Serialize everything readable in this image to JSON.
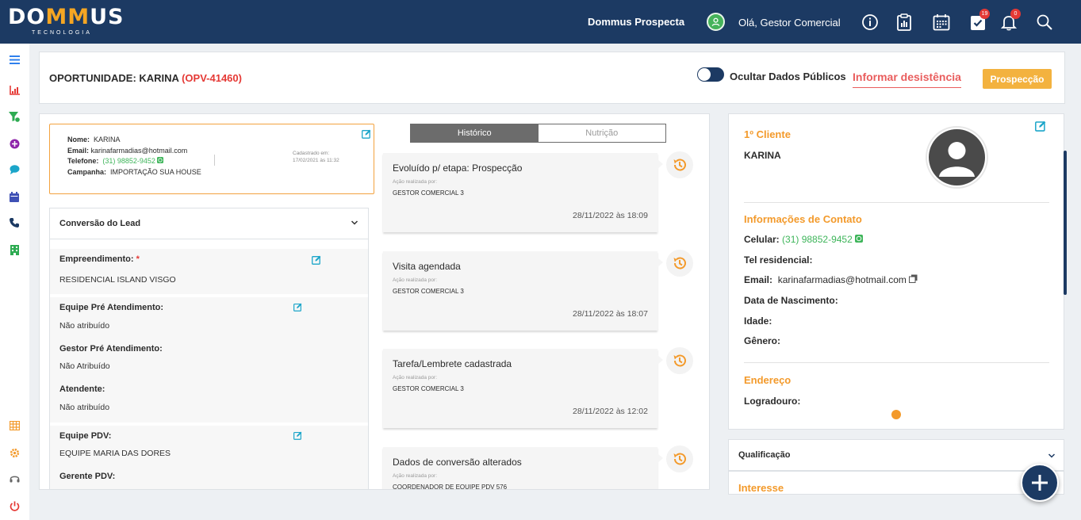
{
  "brand": {
    "logo_part1": "DO",
    "logo_m": "MM",
    "logo_part2": "US",
    "logo_sub": "TECNOLOGIA"
  },
  "topbar": {
    "app_name": "Dommus Prospecta",
    "greeting": "Olá, Gestor Comercial",
    "tasks_badge": "19",
    "notifications_badge": "0"
  },
  "header": {
    "opportunity_label": "OPORTUNIDADE: KARINA",
    "opportunity_code": "(OPV-41460)",
    "toggle_label": "Ocultar Dados Públicos",
    "desist_link": "Informar desistência",
    "stage_button": "Prospecção"
  },
  "lead": {
    "name_label": "Nome:",
    "name": "KARINA",
    "email_label": "Email:",
    "email": "karinafarmadias@hotmail.com",
    "phone_label": "Telefone:",
    "phone": "(31) 98852-9452",
    "campaign_label": "Campanha:",
    "campaign": "IMPORTAÇÃO SUA HOUSE",
    "created_label": "Cadastrado em:",
    "created_at": "17/02/2021 às 11:32"
  },
  "conversion": {
    "title": "Conversão do Lead",
    "empreendimento_label": "Empreendimento:",
    "empreendimento_required": "*",
    "empreendimento": "RESIDENCIAL ISLAND VISGO",
    "equipe_pre_label": "Equipe Pré Atendimento:",
    "equipe_pre": "Não atribuído",
    "gestor_pre_label": "Gestor Pré Atendimento:",
    "gestor_pre": "Não Atribuído",
    "atendente_label": "Atendente:",
    "atendente": "Não atribuído",
    "equipe_pdv_label": "Equipe PDV:",
    "equipe_pdv": "EQUIPE MARIA DAS DORES",
    "gerente_pdv_label": "Gerente PDV:"
  },
  "tabs": {
    "historico": "Histórico",
    "nutricao": "Nutrição"
  },
  "history": [
    {
      "title": "Evoluído p/ etapa: Prospecção",
      "by_label": "Ação realizada por:",
      "user": "GESTOR COMERCIAL 3",
      "date": "28/11/2022 às 18:09"
    },
    {
      "title": "Visita agendada",
      "by_label": "Ação realizada por:",
      "user": "GESTOR COMERCIAL 3",
      "date": "28/11/2022 às 18:07"
    },
    {
      "title": "Tarefa/Lembrete cadastrada",
      "by_label": "Ação realizada por:",
      "user": "GESTOR COMERCIAL 3",
      "date": "28/11/2022 às 12:02"
    },
    {
      "title": "Dados de conversão alterados",
      "by_label": "Ação realizada por:",
      "user": "COORDENADOR DE EQUIPE PDV 576",
      "date": ""
    }
  ],
  "client": {
    "section_title": "1º Cliente",
    "name": "KARINA",
    "contact_title": "Informações de Contato",
    "cell_label": "Celular:",
    "cell": "(31) 98852-9452",
    "home_phone_label": "Tel residencial:",
    "email_label": "Email:",
    "email": "karinafarmadias@hotmail.com",
    "birth_label": "Data de Nascimento:",
    "age_label": "Idade:",
    "gender_label": "Gênero:",
    "address_title": "Endereço",
    "street_label": "Logradouro:"
  },
  "accordions": {
    "qualification": "Qualificação",
    "interest": "Interesse"
  },
  "colors": {
    "navy": "#1c3a63",
    "orange": "#f39a2b",
    "red": "#e53935",
    "green": "#3eb55a",
    "stage_yellow": "#f3b23f"
  }
}
